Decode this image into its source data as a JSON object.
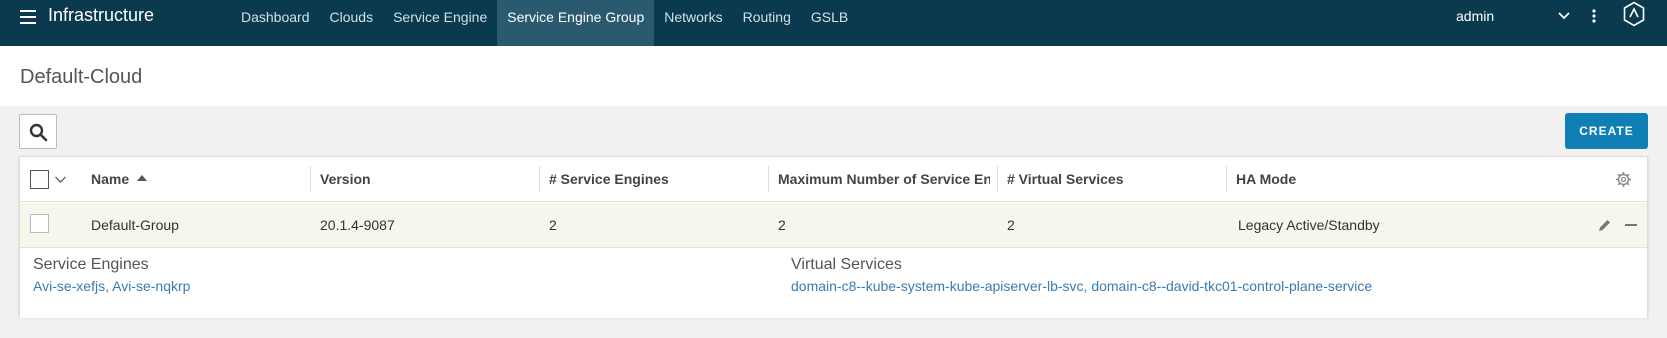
{
  "topbar": {
    "title": "Infrastructure",
    "nav": [
      {
        "label": "Dashboard",
        "active": false
      },
      {
        "label": "Clouds",
        "active": false
      },
      {
        "label": "Service Engine",
        "active": false
      },
      {
        "label": "Service Engine Group",
        "active": true
      },
      {
        "label": "Networks",
        "active": false
      },
      {
        "label": "Routing",
        "active": false
      },
      {
        "label": "GSLB",
        "active": false
      }
    ],
    "user": "admin",
    "bg_color": "#0b3a4e",
    "active_color": "#2b5a70"
  },
  "page": {
    "title": "Default-Cloud"
  },
  "toolbar": {
    "create_label": "CREATE",
    "create_color": "#0f7fb6"
  },
  "table": {
    "columns": [
      "Name",
      "Version",
      "# Service Engines",
      "Maximum Number of Service En...",
      "# Virtual Services",
      "HA Mode"
    ],
    "sorted_column": "Name",
    "rows": [
      {
        "name": "Default-Group",
        "version": "20.1.4-9087",
        "service_engines": "2",
        "max_service_engines": "2",
        "virtual_services": "2",
        "ha_mode": "Legacy Active/Standby"
      }
    ],
    "details": {
      "service_engines_title": "Service Engines",
      "service_engines": [
        "Avi-se-xefjs",
        "Avi-se-nqkrp"
      ],
      "virtual_services_title": "Virtual Services",
      "virtual_services": [
        "domain-c8--kube-system-kube-apiserver-lb-svc",
        "domain-c8--david-tkc01-control-plane-service"
      ]
    }
  },
  "icons": [
    "menu-icon",
    "chevron-down-icon",
    "more-vertical-icon",
    "avi-logo-icon",
    "search-icon",
    "sort-asc-icon",
    "gear-icon",
    "edit-icon",
    "minus-icon"
  ]
}
